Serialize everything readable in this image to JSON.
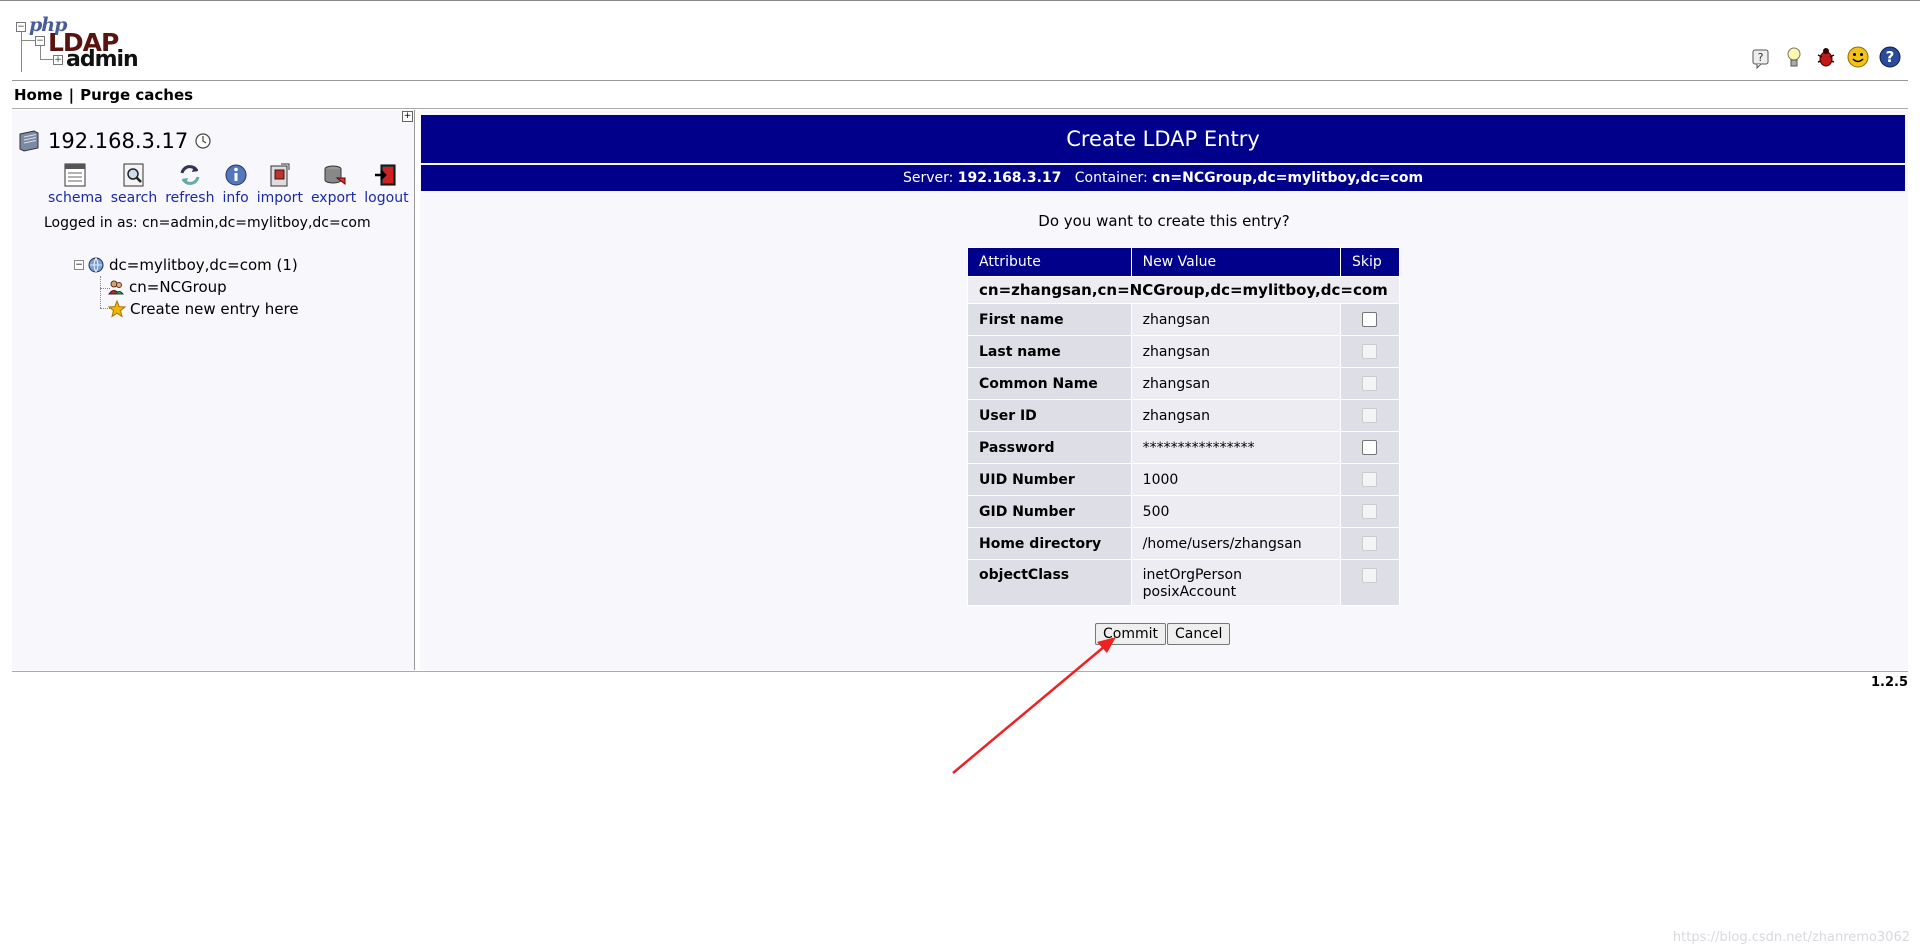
{
  "header": {
    "logo_php": "php",
    "logo_ldap": "LDAP",
    "logo_admin": "admin",
    "icons": [
      "help-icon",
      "bulb-icon",
      "bug-icon",
      "smiley-icon",
      "question-icon"
    ]
  },
  "menu": {
    "home": "Home",
    "separator": "|",
    "purge": "Purge caches"
  },
  "sidebar": {
    "server": "192.168.3.17",
    "tools": [
      {
        "label": "schema",
        "icon": "schema-icon"
      },
      {
        "label": "search",
        "icon": "search-icon"
      },
      {
        "label": "refresh",
        "icon": "refresh-icon"
      },
      {
        "label": "info",
        "icon": "info-icon"
      },
      {
        "label": "import",
        "icon": "import-icon"
      },
      {
        "label": "export",
        "icon": "export-icon"
      },
      {
        "label": "logout",
        "icon": "logout-icon"
      }
    ],
    "logged_in": "Logged in as: cn=admin,dc=mylitboy,dc=com",
    "tree": {
      "root": "dc=mylitboy,dc=com (1)",
      "child": "cn=NCGroup",
      "create": "Create new entry here"
    }
  },
  "main": {
    "title": "Create LDAP Entry",
    "server_label": "Server:",
    "server_value": "192.168.3.17",
    "container_label": "Container:",
    "container_value": "cn=NCGroup,dc=mylitboy,dc=com",
    "question": "Do you want to create this entry?",
    "columns": {
      "attribute": "Attribute",
      "new_value": "New Value",
      "skip": "Skip"
    },
    "dn": "cn=zhangsan,cn=NCGroup,dc=mylitboy,dc=com",
    "rows": [
      {
        "attr": "First name",
        "value": "zhangsan"
      },
      {
        "attr": "Last name",
        "value": "zhangsan"
      },
      {
        "attr": "Common Name",
        "value": "zhangsan"
      },
      {
        "attr": "User ID",
        "value": "zhangsan"
      },
      {
        "attr": "Password",
        "value": "****************"
      },
      {
        "attr": "UID Number",
        "value": "1000"
      },
      {
        "attr": "GID Number",
        "value": "500"
      },
      {
        "attr": "Home directory",
        "value": "/home/users/zhangsan"
      },
      {
        "attr": "objectClass",
        "value": "inetOrgPerson",
        "value2": "posixAccount"
      }
    ],
    "commit": "Commit",
    "cancel": "Cancel"
  },
  "footer": {
    "version": "1.2.5",
    "watermark": "https://blog.csdn.net/zhanremo3062"
  },
  "colors": {
    "header_bg": "#00008b",
    "link": "#1a2aa8",
    "arrow": "#ee2222"
  }
}
